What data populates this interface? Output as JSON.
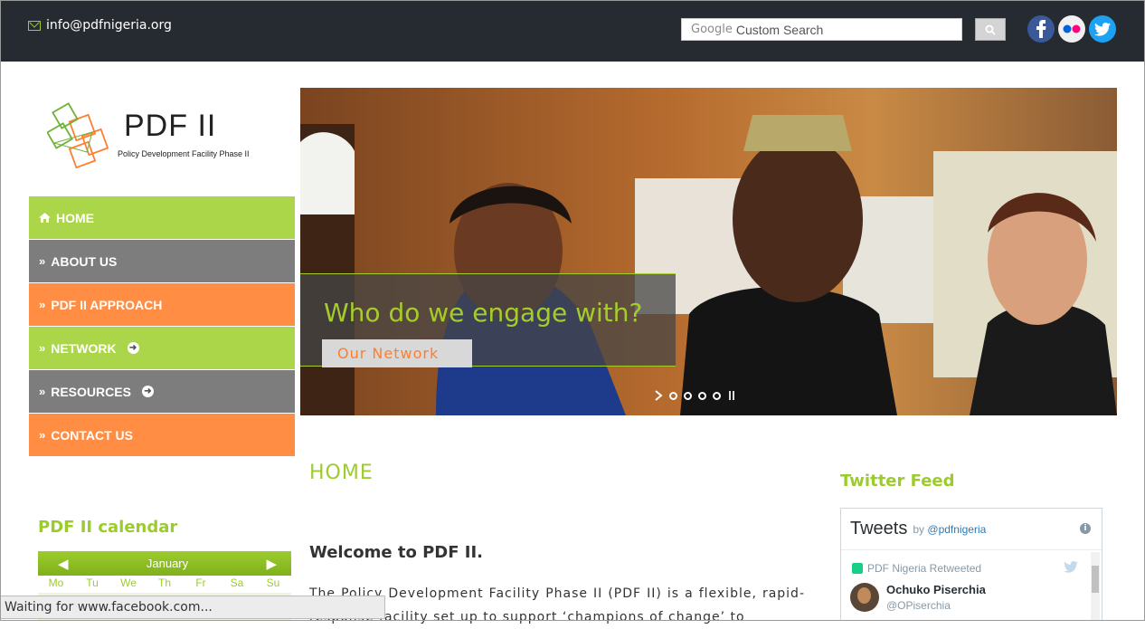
{
  "header": {
    "email": "info@pdfnigeria.org",
    "search_brand": "Google",
    "search_placeholder": "Custom Search",
    "social": [
      "facebook-icon",
      "flickr-icon",
      "twitter-icon"
    ]
  },
  "logo": {
    "title": "PDF II",
    "subtitle": "Policy Development Facility Phase II"
  },
  "menu": {
    "items": [
      {
        "label": "HOME",
        "icon": "home-icon",
        "color": "#abd64a"
      },
      {
        "label": "ABOUT US",
        "color": "#7d7d7d"
      },
      {
        "label": "PDF II APPROACH",
        "color": "#ff8d43"
      },
      {
        "label": "NETWORK",
        "color": "#abd64a",
        "has_submenu": true
      },
      {
        "label": "RESOURCES",
        "color": "#7d7d7d",
        "has_submenu": true
      },
      {
        "label": "CONTACT US",
        "color": "#ff8d43"
      }
    ]
  },
  "slider": {
    "caption": "Who do we engage with?",
    "button": "Our Network",
    "slide_count": 4,
    "controls": [
      "next-icon",
      "pause-icon"
    ]
  },
  "main": {
    "title": "HOME",
    "welcome": "Welcome to PDF II.",
    "paragraph": "The Policy Development Facility Phase II (PDF II) is a flexible, rapid-response facility set up to support ‘champions of change’ to"
  },
  "twitter": {
    "section_title": "Twitter Feed",
    "header": "Tweets",
    "by_prefix": "by",
    "by_handle": "@pdfnigeria",
    "retweet_note": "PDF Nigeria Retweeted",
    "user_name": "Ochuko Piserchia",
    "user_handle": "@OPiserchia"
  },
  "calendar": {
    "title": "PDF II calendar",
    "month": "January",
    "weekdays": [
      "Mo",
      "Tu",
      "We",
      "Th",
      "Fr",
      "Sa",
      "Su"
    ]
  },
  "status_bar": {
    "text": "Waiting for www.facebook.com..."
  },
  "colors": {
    "accent_green": "#9ccc2c",
    "accent_orange": "#ff8d43",
    "topbar": "#262a31"
  }
}
